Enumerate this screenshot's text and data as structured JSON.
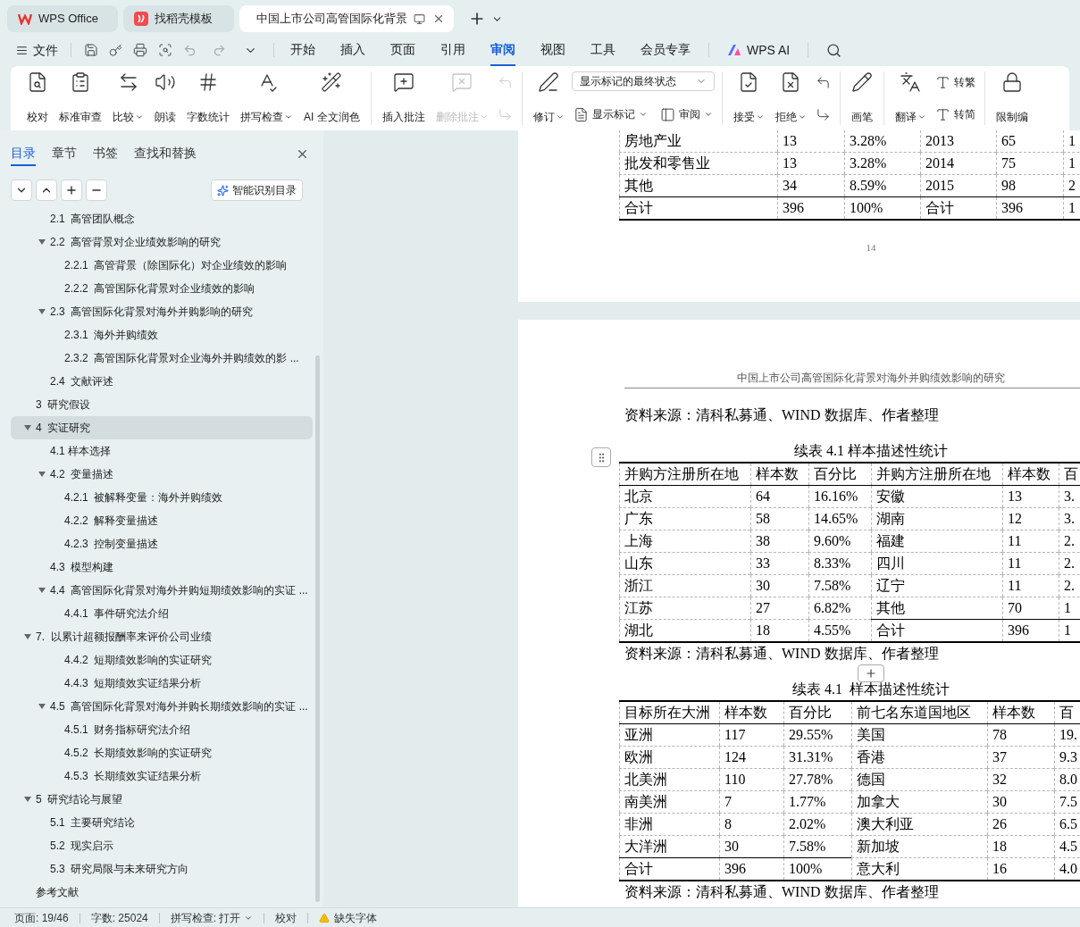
{
  "tab_bar": {
    "tabs": [
      {
        "kind": "home",
        "label": "WPS Office",
        "selected": false
      },
      {
        "kind": "template",
        "label": "找稻壳模板",
        "selected": false
      },
      {
        "kind": "doc",
        "label": "中国上市公司高管国际化背景",
        "selected": true
      }
    ]
  },
  "menu_bar": {
    "file": "文件",
    "tabs": [
      {
        "label": "开始",
        "selected": false
      },
      {
        "label": "插入",
        "selected": false
      },
      {
        "label": "页面",
        "selected": false
      },
      {
        "label": "引用",
        "selected": false
      },
      {
        "label": "审阅",
        "selected": true
      },
      {
        "label": "视图",
        "selected": false
      },
      {
        "label": "工具",
        "selected": false
      },
      {
        "label": "会员专享",
        "selected": false
      }
    ],
    "ai": "WPS AI"
  },
  "ribbon": {
    "groups": [
      {
        "items": [
          {
            "kind": "big",
            "label": "校对",
            "dropdown": false,
            "disabled": false
          },
          {
            "kind": "big",
            "label": "标准审查",
            "dropdown": false,
            "disabled": false
          },
          {
            "kind": "big",
            "label": "比较",
            "dropdown": true,
            "disabled": false
          },
          {
            "kind": "big",
            "label": "朗读",
            "dropdown": false,
            "disabled": false
          },
          {
            "kind": "big",
            "label": "字数统计",
            "dropdown": false,
            "disabled": false
          },
          {
            "kind": "big",
            "label": "拼写检查",
            "dropdown": true,
            "disabled": false
          },
          {
            "kind": "big",
            "label": "AI 全文润色",
            "dropdown": false,
            "disabled": false
          }
        ]
      },
      {
        "items": [
          {
            "kind": "big",
            "label": "插入批注",
            "dropdown": false,
            "disabled": false
          },
          {
            "kind": "big",
            "label": "删除批注",
            "dropdown": true,
            "disabled": true
          },
          {
            "kind": "stack",
            "rows": [
              [
                {
                  "kind": "small",
                  "dropdown": false,
                  "disabled": true
                }
              ],
              [
                {
                  "kind": "small",
                  "dropdown": false,
                  "disabled": true
                }
              ]
            ]
          }
        ]
      },
      {
        "items": [
          {
            "kind": "big",
            "label": "修订",
            "dropdown": true,
            "disabled": false
          },
          {
            "kind": "stack",
            "rows": [
              [
                {
                  "kind": "select",
                  "value": "显示标记的最终状态"
                }
              ],
              [
                {
                  "kind": "small",
                  "label": "显示标记",
                  "dropdown": true,
                  "disabled": false
                },
                {
                  "kind": "small",
                  "label": "审阅",
                  "dropdown": true,
                  "disabled": false
                }
              ]
            ]
          }
        ]
      },
      {
        "items": [
          {
            "kind": "big",
            "label": "接受",
            "dropdown": true,
            "disabled": false
          },
          {
            "kind": "big",
            "label": "拒绝",
            "dropdown": true,
            "disabled": false
          },
          {
            "kind": "stack",
            "rows": [
              [
                {
                  "kind": "small",
                  "dropdown": false,
                  "disabled": false
                }
              ],
              [
                {
                  "kind": "small",
                  "dropdown": false,
                  "disabled": false
                }
              ]
            ]
          }
        ]
      },
      {
        "items": [
          {
            "kind": "big",
            "label": "画笔",
            "dropdown": false,
            "disabled": false
          }
        ]
      },
      {
        "items": [
          {
            "kind": "big",
            "label": "翻译",
            "dropdown": true,
            "disabled": false
          },
          {
            "kind": "stack",
            "rows": [
              [
                {
                  "kind": "small",
                  "label": "转繁",
                  "dropdown": false,
                  "disabled": false
                }
              ],
              [
                {
                  "kind": "small",
                  "label": "转简",
                  "dropdown": false,
                  "disabled": false
                }
              ]
            ]
          }
        ]
      },
      {
        "items": [
          {
            "kind": "big",
            "label": "限制编",
            "dropdown": false,
            "disabled": false
          }
        ]
      }
    ]
  },
  "sidebar": {
    "tabs": [
      {
        "label": "目录",
        "selected": true
      },
      {
        "label": "章节",
        "selected": false
      },
      {
        "label": "书签",
        "selected": false
      },
      {
        "label": "查找和替换",
        "selected": false
      }
    ],
    "smart_button": "智能识别目录",
    "toc": [
      {
        "label": "2.1  高管团队概念",
        "selected": false
      },
      {
        "label": "2.2  高管背景对企业绩效影响的研究",
        "selected": false,
        "expanded": true,
        "children": [
          {
            "label": "2.2.1  高管背景（除国际化）对企业绩效的影响",
            "selected": false
          },
          {
            "label": "2.2.2  高管国际化背景对企业绩效的影响",
            "selected": false
          }
        ]
      },
      {
        "label": "2.3  高管国际化背景对海外并购影响的研究",
        "selected": false,
        "expanded": true,
        "children": [
          {
            "label": "2.3.1  海外并购绩效",
            "selected": false
          },
          {
            "label": "2.3.2  高管国际化背景对企业海外并购绩效的影 ...",
            "selected": false
          }
        ]
      },
      {
        "label": "2.4  文献评述",
        "selected": false
      },
      {
        "label": "3  研究假设",
        "selected": false,
        "top": true
      },
      {
        "label": "4  实证研究",
        "selected": true,
        "top": true,
        "expanded": true,
        "children": [
          {
            "label": "4.1 样本选择",
            "selected": false
          },
          {
            "label": "4.2  变量描述",
            "selected": false,
            "expanded": true,
            "children": [
              {
                "label": "4.2.1  被解释变量：海外并购绩效",
                "selected": false
              },
              {
                "label": "4.2.2  解释变量描述",
                "selected": false
              },
              {
                "label": "4.2.3  控制变量描述",
                "selected": false
              }
            ]
          },
          {
            "label": "4.3  模型构建",
            "selected": false
          },
          {
            "label": "4.4  高管国际化背景对海外并购短期绩效影响的实证 ...",
            "selected": false,
            "expanded": true,
            "children": [
              {
                "label": "4.4.1  事件研究法介绍",
                "selected": false
              }
            ]
          }
        ]
      },
      {
        "label": "7.  以累计超额报酬率来评价公司业绩",
        "selected": false,
        "top": true,
        "expanded": true,
        "children": [
          {
            "children": [
              {
                "label": "4.4.2  短期绩效影响的实证研究",
                "selected": false
              },
              {
                "label": "4.4.3  短期绩效实证结果分析",
                "selected": false
              }
            ]
          },
          {
            "label": "4.5  高管国际化背景对海外并购长期绩效影响的实证 ...",
            "selected": false,
            "expanded": true,
            "children": [
              {
                "label": "4.5.1  财务指标研究法介绍",
                "selected": false
              },
              {
                "label": "4.5.2  长期绩效影响的实证研究",
                "selected": false
              },
              {
                "label": "4.5.3  长期绩效实证结果分析",
                "selected": false
              }
            ]
          }
        ]
      },
      {
        "label": "5  研究结论与展望",
        "selected": false,
        "top": true,
        "expanded": true,
        "children": [
          {
            "label": "5.1  主要研究结论",
            "selected": false
          },
          {
            "label": "5.2  现实启示",
            "selected": false
          },
          {
            "label": "5.3  研究局限与未来研究方向",
            "selected": false
          }
        ]
      },
      {
        "label": "参考文献",
        "selected": false,
        "top": true
      }
    ]
  },
  "document": {
    "pages": [
      {
        "blocks": [
          {
            "kind": "table",
            "rows": [
              {
                "cells": [
                  "房地产业",
                  "13",
                  "3.28%",
                  "2013",
                  "65",
                  "1"
                ]
              },
              {
                "cells": [
                  "批发和零售业",
                  "13",
                  "3.28%",
                  "2014",
                  "75",
                  "1"
                ]
              },
              {
                "cells": [
                  "其他",
                  "34",
                  "8.59%",
                  "2015",
                  "98",
                  "2"
                ]
              },
              {
                "cells": [
                  "合计",
                  "396",
                  "100%",
                  "合计",
                  "396",
                  "1"
                ],
                "rule_left": true,
                "rule_right": true
              }
            ]
          },
          {
            "kind": "page_number",
            "text": "14"
          }
        ]
      },
      {
        "header": "中国上市公司高管国际化背景对海外并购绩效影响的研究",
        "blocks": [
          {
            "kind": "source",
            "text": "资料来源：清科私募通、WIND 数据库、作者整理"
          },
          {
            "kind": "caption",
            "text": "续表 4.1 样本描述性统计"
          },
          {
            "kind": "table",
            "handle": true,
            "insert_button": true,
            "header": [
              "并购方注册所在地",
              "样本数",
              "百分比",
              "并购方注册所在地",
              "样本数",
              "百"
            ],
            "rows": [
              {
                "cells": [
                  "北京",
                  "64",
                  "16.16%",
                  "安徽",
                  "13",
                  "3."
                ]
              },
              {
                "cells": [
                  "广东",
                  "58",
                  "14.65%",
                  "湖南",
                  "12",
                  "3."
                ]
              },
              {
                "cells": [
                  "上海",
                  "38",
                  "9.60%",
                  "福建",
                  "11",
                  "2."
                ]
              },
              {
                "cells": [
                  "山东",
                  "33",
                  "8.33%",
                  "四川",
                  "11",
                  "2."
                ]
              },
              {
                "cells": [
                  "浙江",
                  "30",
                  "7.58%",
                  "辽宁",
                  "11",
                  "2."
                ]
              },
              {
                "cells": [
                  "江苏",
                  "27",
                  "6.82%",
                  "其他",
                  "70",
                  "1"
                ]
              },
              {
                "cells": [
                  "湖北",
                  "18",
                  "4.55%",
                  "合计",
                  "396",
                  "1"
                ],
                "rule_right": true
              }
            ]
          },
          {
            "kind": "source",
            "text": "资料来源：清科私募通、WIND 数据库、作者整理"
          },
          {
            "kind": "caption",
            "text": "续表 4.1  样本描述性统计"
          },
          {
            "kind": "table",
            "header": [
              "目标所在大洲",
              "样本数",
              "百分比",
              "前七名东道国地区",
              "样本数",
              "百"
            ],
            "rows": [
              {
                "cells": [
                  "亚洲",
                  "117",
                  "29.55%",
                  "美国",
                  "78",
                  "19."
                ]
              },
              {
                "cells": [
                  "欧洲",
                  "124",
                  "31.31%",
                  "香港",
                  "37",
                  "9.3"
                ]
              },
              {
                "cells": [
                  "北美洲",
                  "110",
                  "27.78%",
                  "德国",
                  "32",
                  "8.0"
                ]
              },
              {
                "cells": [
                  "南美洲",
                  "7",
                  "1.77%",
                  "加拿大",
                  "30",
                  "7.5"
                ]
              },
              {
                "cells": [
                  "非洲",
                  "8",
                  "2.02%",
                  "澳大利亚",
                  "26",
                  "6.5"
                ]
              },
              {
                "cells": [
                  "大洋洲",
                  "30",
                  "7.58%",
                  "新加坡",
                  "18",
                  "4.5"
                ]
              },
              {
                "cells": [
                  "合计",
                  "396",
                  "100%",
                  "意大利",
                  "16",
                  "4.0"
                ],
                "rule_left": true
              }
            ]
          },
          {
            "kind": "source",
            "text": "资料来源：清科私募通、WIND 数据库、作者整理"
          }
        ]
      }
    ]
  },
  "status_bar": {
    "items": [
      {
        "kind": "text",
        "label": "页面: 19/46"
      },
      {
        "kind": "text",
        "label": "字数: 25024"
      },
      {
        "kind": "dropdown",
        "label": "拼写检查: 打开"
      },
      {
        "kind": "text",
        "label": "校对"
      },
      {
        "kind": "warning",
        "label": "缺失字体"
      }
    ]
  }
}
